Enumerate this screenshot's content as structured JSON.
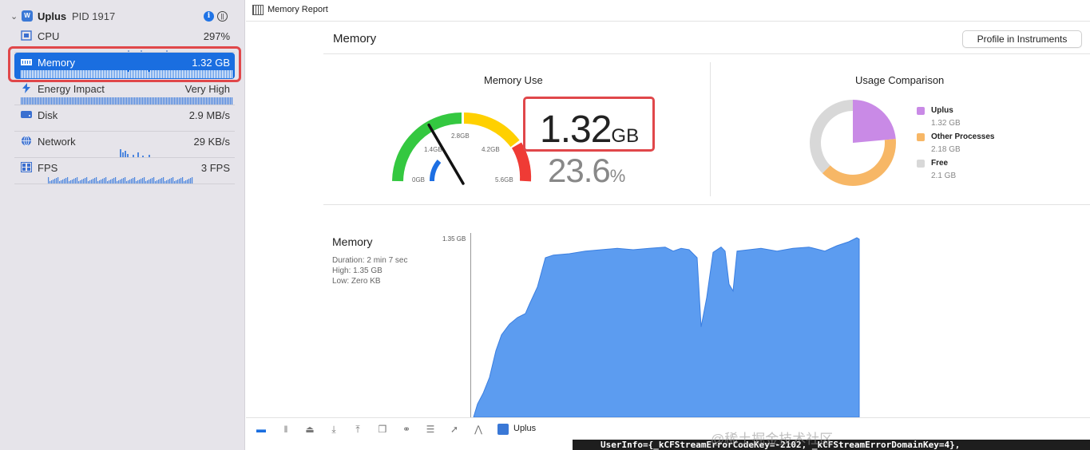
{
  "process": {
    "name": "Uplus",
    "pid": "PID 1917"
  },
  "gauges": [
    {
      "label": "CPU",
      "value": "297%"
    },
    {
      "label": "Memory",
      "value": "1.32 GB"
    },
    {
      "label": "Energy Impact",
      "value": "Very High"
    },
    {
      "label": "Disk",
      "value": "2.9 MB/s"
    },
    {
      "label": "Network",
      "value": "29 KB/s"
    },
    {
      "label": "FPS",
      "value": "3 FPS"
    }
  ],
  "report": {
    "tab_title": "Memory Report",
    "heading": "Memory",
    "profile_button": "Profile in Instruments",
    "memory_use": {
      "title": "Memory Use",
      "value": "1.32",
      "unit": "GB",
      "percent": "23.6",
      "percent_unit": "%",
      "gauge_ticks": [
        "0GB",
        "1.4GB",
        "2.8GB",
        "4.2GB",
        "5.6GB"
      ],
      "needle_fraction": 0.236
    },
    "usage_comparison": {
      "title": "Usage Comparison",
      "items": [
        {
          "name": "Uplus",
          "value": "1.32 GB",
          "color": "#c98ae6",
          "gb": 1.32
        },
        {
          "name": "Other Processes",
          "value": "2.18 GB",
          "color": "#f7b766",
          "gb": 2.18
        },
        {
          "name": "Free",
          "value": "2.1 GB",
          "color": "#d8d8d8",
          "gb": 2.1
        }
      ]
    },
    "memory_graph": {
      "title": "Memory",
      "duration": "Duration: 2 min 7 sec",
      "high": "High: 1.35 GB",
      "low": "Low: Zero KB",
      "axis_max": "1.35 GB",
      "fill_color": "#5c9cf0"
    }
  },
  "bottom": {
    "process_label": "Uplus"
  },
  "console_text": "UserInfo={_kCFStreamErrorCodeKey=-2102, _kCFStreamErrorDomainKey=4},",
  "watermark": "@稀土掘金技术社区"
}
